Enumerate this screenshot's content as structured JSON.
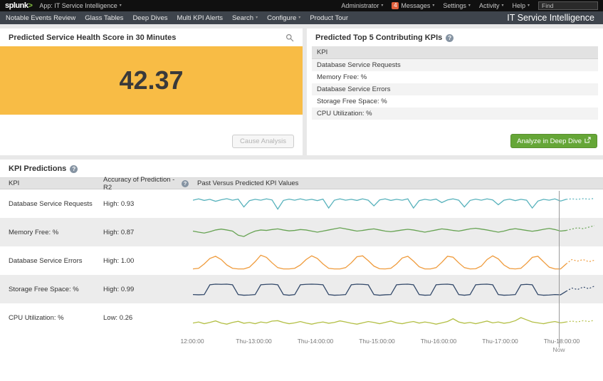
{
  "topbar": {
    "logo_text": "splunk",
    "logo_caret": ">",
    "app_menu": "App: IT Service Intelligence",
    "user": "Administrator",
    "messages_count": "4",
    "messages_label": "Messages",
    "settings_label": "Settings",
    "activity_label": "Activity",
    "help_label": "Help",
    "find_placeholder": "Find"
  },
  "navbar": {
    "items": [
      "Notable Events Review",
      "Glass Tables",
      "Deep Dives",
      "Multi KPI Alerts",
      "Search",
      "Configure",
      "Product Tour"
    ],
    "app_title": "IT Service Intelligence"
  },
  "health_panel": {
    "title": "Predicted Service Health Score in 30 Minutes",
    "score": "42.37",
    "score_color": "#f8bc45",
    "cause_analysis_label": "Cause Analysis"
  },
  "contributing_panel": {
    "title": "Predicted Top 5 Contributing KPIs",
    "header": "KPI",
    "rows": [
      "Database Service Requests",
      "Memory Free: %",
      "Database Service Errors",
      "Storage Free Space: %",
      "CPU Utilization: %"
    ],
    "analyze_button": "Analyze in Deep Dive"
  },
  "kpi_predictions": {
    "title": "KPI Predictions",
    "columns": [
      "KPI",
      "Accuracy of Prediction - R2",
      "Past Versus Predicted KPI Values"
    ],
    "now_index": 66,
    "axis": {
      "ticks": [
        "12:00:00",
        "Thu-13:00:00",
        "Thu-14:00:00",
        "Thu-15:00:00",
        "Thu-16:00:00",
        "Thu-17:00:00",
        "Thu-18:00:00"
      ],
      "now_label": "Now"
    },
    "rows": [
      {
        "kpi": "Database Service Requests",
        "accuracy": "High: 0.93",
        "color": "#58b2bc",
        "series": [
          0.66,
          0.72,
          0.65,
          0.7,
          0.61,
          0.68,
          0.73,
          0.66,
          0.71,
          0.35,
          0.64,
          0.7,
          0.66,
          0.72,
          0.67,
          0.25,
          0.65,
          0.71,
          0.66,
          0.72,
          0.66,
          0.7,
          0.64,
          0.71,
          0.3,
          0.66,
          0.72,
          0.66,
          0.7,
          0.65,
          0.72,
          0.66,
          0.4,
          0.67,
          0.72,
          0.65,
          0.7,
          0.66,
          0.72,
          0.3,
          0.64,
          0.7,
          0.66,
          0.71,
          0.55,
          0.67,
          0.72,
          0.66,
          0.35,
          0.65,
          0.71,
          0.66,
          0.72,
          0.67,
          0.45,
          0.66,
          0.71,
          0.64,
          0.7,
          0.66,
          0.3,
          0.62,
          0.7,
          0.66,
          0.72,
          0.62,
          0.7,
          0.72,
          0.7,
          0.73,
          0.71,
          0.74
        ]
      },
      {
        "kpi": "Memory Free: %",
        "accuracy": "High: 0.87",
        "color": "#67a353",
        "series": [
          0.55,
          0.5,
          0.46,
          0.52,
          0.6,
          0.64,
          0.6,
          0.55,
          0.36,
          0.3,
          0.44,
          0.55,
          0.6,
          0.58,
          0.62,
          0.65,
          0.6,
          0.56,
          0.58,
          0.62,
          0.6,
          0.55,
          0.5,
          0.55,
          0.6,
          0.65,
          0.7,
          0.65,
          0.6,
          0.55,
          0.58,
          0.62,
          0.65,
          0.6,
          0.55,
          0.52,
          0.56,
          0.6,
          0.63,
          0.6,
          0.55,
          0.5,
          0.55,
          0.6,
          0.65,
          0.62,
          0.58,
          0.55,
          0.6,
          0.65,
          0.68,
          0.64,
          0.6,
          0.55,
          0.5,
          0.55,
          0.62,
          0.66,
          0.62,
          0.58,
          0.54,
          0.58,
          0.63,
          0.67,
          0.62,
          0.55,
          0.58,
          0.64,
          0.7,
          0.66,
          0.73,
          0.8
        ]
      },
      {
        "kpi": "Database Service Errors",
        "accuracy": "High: 1.00",
        "color": "#ef9b3c",
        "series": [
          0.12,
          0.15,
          0.35,
          0.6,
          0.7,
          0.55,
          0.3,
          0.15,
          0.12,
          0.12,
          0.2,
          0.45,
          0.75,
          0.65,
          0.4,
          0.18,
          0.12,
          0.12,
          0.15,
          0.3,
          0.55,
          0.72,
          0.6,
          0.35,
          0.15,
          0.12,
          0.12,
          0.18,
          0.4,
          0.68,
          0.72,
          0.5,
          0.25,
          0.13,
          0.12,
          0.15,
          0.35,
          0.62,
          0.7,
          0.48,
          0.22,
          0.12,
          0.12,
          0.18,
          0.42,
          0.7,
          0.66,
          0.4,
          0.18,
          0.12,
          0.13,
          0.25,
          0.55,
          0.72,
          0.58,
          0.3,
          0.14,
          0.12,
          0.15,
          0.38,
          0.65,
          0.7,
          0.45,
          0.2,
          0.12,
          0.12,
          0.35,
          0.55,
          0.48,
          0.55,
          0.45,
          0.52
        ]
      },
      {
        "kpi": "Storage Free Space: %",
        "accuracy": "High: 0.99",
        "color": "#33496a",
        "series": [
          0.25,
          0.24,
          0.25,
          0.7,
          0.73,
          0.72,
          0.73,
          0.7,
          0.25,
          0.22,
          0.23,
          0.25,
          0.7,
          0.72,
          0.73,
          0.7,
          0.25,
          0.22,
          0.25,
          0.7,
          0.72,
          0.73,
          0.72,
          0.7,
          0.25,
          0.22,
          0.23,
          0.25,
          0.7,
          0.73,
          0.72,
          0.7,
          0.25,
          0.22,
          0.24,
          0.25,
          0.7,
          0.72,
          0.73,
          0.7,
          0.25,
          0.22,
          0.23,
          0.7,
          0.72,
          0.73,
          0.7,
          0.25,
          0.22,
          0.25,
          0.7,
          0.72,
          0.73,
          0.7,
          0.25,
          0.22,
          0.23,
          0.25,
          0.7,
          0.72,
          0.7,
          0.25,
          0.22,
          0.23,
          0.25,
          0.24,
          0.4,
          0.55,
          0.48,
          0.6,
          0.52,
          0.64
        ]
      },
      {
        "kpi": "CPU Utilization: %",
        "accuracy": "Low: 0.26",
        "color": "#b3bf45",
        "series": [
          0.25,
          0.3,
          0.22,
          0.28,
          0.35,
          0.25,
          0.2,
          0.28,
          0.33,
          0.24,
          0.28,
          0.22,
          0.3,
          0.26,
          0.34,
          0.36,
          0.28,
          0.22,
          0.26,
          0.32,
          0.25,
          0.2,
          0.26,
          0.3,
          0.24,
          0.28,
          0.35,
          0.3,
          0.24,
          0.2,
          0.26,
          0.32,
          0.28,
          0.22,
          0.28,
          0.34,
          0.26,
          0.22,
          0.28,
          0.32,
          0.25,
          0.3,
          0.26,
          0.2,
          0.26,
          0.32,
          0.45,
          0.3,
          0.24,
          0.28,
          0.22,
          0.28,
          0.34,
          0.26,
          0.3,
          0.24,
          0.28,
          0.36,
          0.5,
          0.4,
          0.3,
          0.26,
          0.22,
          0.28,
          0.32,
          0.26,
          0.3,
          0.34,
          0.3,
          0.36,
          0.32,
          0.38
        ]
      }
    ]
  }
}
